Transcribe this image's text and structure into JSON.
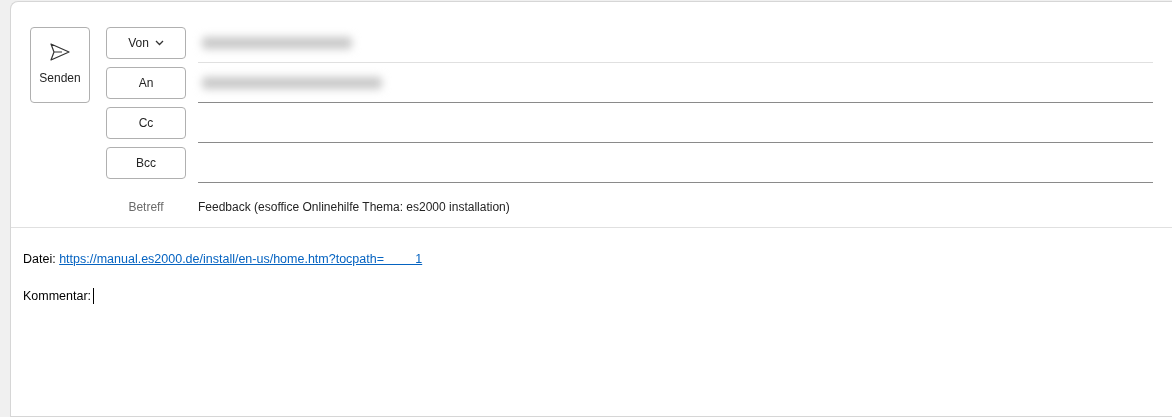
{
  "send_button": {
    "label": "Senden"
  },
  "address_rows": [
    {
      "label": "Von",
      "kind": "dropdown",
      "redacted": true
    },
    {
      "label": "An",
      "kind": "button",
      "redacted": true
    },
    {
      "label": "Cc",
      "kind": "button",
      "redacted": false
    },
    {
      "label": "Bcc",
      "kind": "button",
      "redacted": false
    }
  ],
  "subject": {
    "label": "Betreff",
    "value": "Feedback (esoffice Onlinehilfe Thema: es2000 installation)"
  },
  "body": {
    "file_label": "Datei:",
    "link": "https://manual.es2000.de/install/en-us/home.htm?tocpath=         1",
    "comment_label": "Kommentar:"
  }
}
